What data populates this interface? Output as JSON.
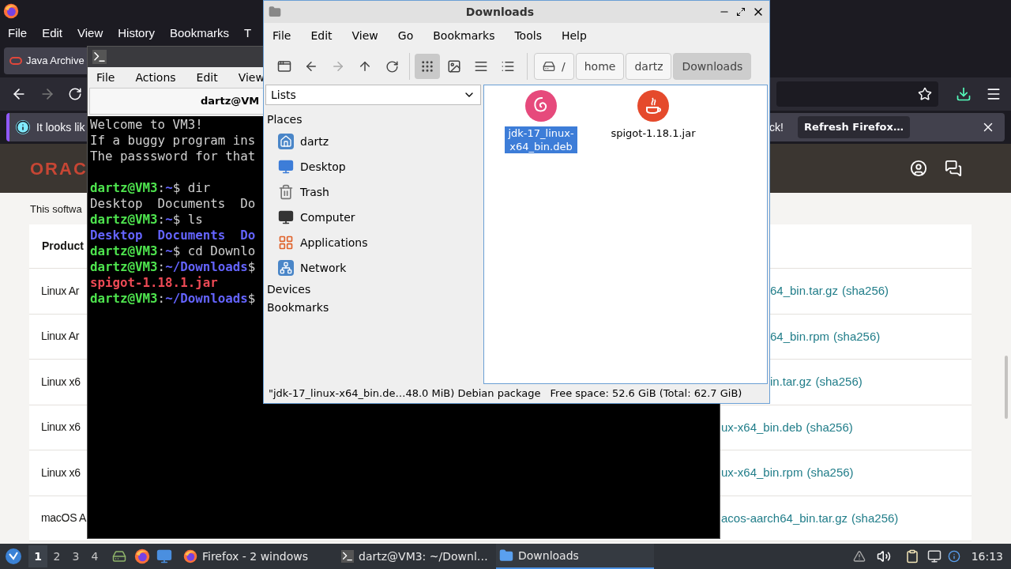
{
  "firefox": {
    "menu": [
      "File",
      "Edit",
      "View",
      "History",
      "Bookmarks",
      "T"
    ],
    "tab": {
      "title": "Java Archive"
    },
    "nav": {
      "back_disabled": false,
      "forward_disabled": true
    },
    "notification": {
      "text": "It looks lik",
      "text_end": "ck!",
      "button": "Refresh Firefox…"
    },
    "site": {
      "logo": "ORAC",
      "notice": "This softwa",
      "header": "Product",
      "rows": [
        {
          "product": "Linux Ar",
          "file": "64_bin.tar.gz",
          "checksum": "(sha256)"
        },
        {
          "product": "Linux Ar",
          "file": "64_bin.rpm",
          "checksum": "(sha256)"
        },
        {
          "product": "Linux x6",
          "file": "in.tar.gz",
          "checksum": "(sha256)"
        },
        {
          "product": "Linux x6",
          "file": "ux-x64_bin.deb",
          "checksum": "(sha256)"
        },
        {
          "product": "Linux x6",
          "file": "ux-x64_bin.rpm",
          "checksum": "(sha256)"
        },
        {
          "product": "macOS A",
          "file": "acos-aarch64_bin.tar.gz",
          "checksum": "(sha256)"
        }
      ]
    }
  },
  "terminal": {
    "menu": [
      "File",
      "Actions",
      "Edit",
      "View"
    ],
    "title": "dartz@VM",
    "lines": [
      {
        "segments": [
          {
            "text": "Welcome to VM3!",
            "kind": "plain"
          }
        ]
      },
      {
        "segments": [
          {
            "text": "If a buggy program ins",
            "kind": "plain"
          }
        ]
      },
      {
        "segments": [
          {
            "text": "The passsword for that",
            "kind": "plain"
          }
        ]
      },
      {
        "kind": "blank"
      },
      {
        "segments": [
          {
            "text": "dartz@VM3",
            "kind": "user"
          },
          {
            "text": ":",
            "kind": "plain"
          },
          {
            "text": "~",
            "kind": "path"
          },
          {
            "text": "$ dir",
            "kind": "plain"
          }
        ]
      },
      {
        "segments": [
          {
            "text": "Desktop  Documents  Do",
            "kind": "plain"
          }
        ]
      },
      {
        "segments": [
          {
            "text": "dartz@VM3",
            "kind": "user"
          },
          {
            "text": ":",
            "kind": "plain"
          },
          {
            "text": "~",
            "kind": "path"
          },
          {
            "text": "$ ls",
            "kind": "plain"
          }
        ]
      },
      {
        "segments": [
          {
            "text": "Desktop  Documents  Do",
            "kind": "dir"
          }
        ]
      },
      {
        "segments": [
          {
            "text": "dartz@VM3",
            "kind": "user"
          },
          {
            "text": ":",
            "kind": "plain"
          },
          {
            "text": "~",
            "kind": "path"
          },
          {
            "text": "$ cd Downlo",
            "kind": "plain"
          }
        ]
      },
      {
        "segments": [
          {
            "text": "dartz@VM3",
            "kind": "user"
          },
          {
            "text": ":",
            "kind": "plain"
          },
          {
            "text": "~/Downloads",
            "kind": "path"
          },
          {
            "text": "$",
            "kind": "plain"
          }
        ]
      },
      {
        "segments": [
          {
            "text": "spigot-1.18.1.jar",
            "kind": "file"
          }
        ]
      },
      {
        "segments": [
          {
            "text": "dartz@VM3",
            "kind": "user"
          },
          {
            "text": ":",
            "kind": "plain"
          },
          {
            "text": "~/Downloads",
            "kind": "path"
          },
          {
            "text": "$",
            "kind": "plain"
          }
        ]
      }
    ]
  },
  "file_manager": {
    "title": "Downloads",
    "menu": [
      "File",
      "Edit",
      "View",
      "Go",
      "Bookmarks",
      "Tools",
      "Help"
    ],
    "views": [
      {
        "kind": "icon",
        "selected": true
      },
      {
        "kind": "thumbnail",
        "selected": false
      },
      {
        "kind": "compact",
        "selected": false
      },
      {
        "kind": "detailed",
        "selected": false
      }
    ],
    "path": [
      {
        "label": "/",
        "kind": "root",
        "selected": false
      },
      {
        "label": "home",
        "kind": "dir",
        "selected": false
      },
      {
        "label": "dartz",
        "kind": "dir",
        "selected": false
      },
      {
        "label": "Downloads",
        "kind": "dir",
        "selected": true
      }
    ],
    "side_mode": "Lists",
    "places_header": "Places",
    "places": [
      {
        "label": "dartz",
        "kind": "home"
      },
      {
        "label": "Desktop",
        "kind": "desktop"
      },
      {
        "label": "Trash",
        "kind": "trash"
      },
      {
        "label": "Computer",
        "kind": "computer"
      },
      {
        "label": "Applications",
        "kind": "apps"
      },
      {
        "label": "Network",
        "kind": "network"
      }
    ],
    "sections": [
      "Devices",
      "Bookmarks"
    ],
    "files": [
      {
        "name": "jdk-17_linux-x64_bin.deb",
        "kind": "debian",
        "selected": true
      },
      {
        "name": "spigot-1.18.1.jar",
        "kind": "java",
        "selected": false
      }
    ],
    "status": [
      "\"jdk-17_linux-x64_bin.de…48.0 MiB) Debian package",
      "Free space: 52.6 GiB (Total: 62.7 GiB)"
    ]
  },
  "taskbar": {
    "workspaces": [
      {
        "label": "1",
        "selected": true
      },
      {
        "label": "2",
        "selected": false
      },
      {
        "label": "3",
        "selected": false
      },
      {
        "label": "4",
        "selected": false
      }
    ],
    "tasks": [
      {
        "label": "Firefox - 2 windows",
        "kind": "firefox",
        "selected": false
      },
      {
        "label": "dartz@VM3: ~/Downl…",
        "kind": "terminal",
        "selected": false
      },
      {
        "label": "Downloads",
        "kind": "folder",
        "selected": true
      }
    ],
    "clock": "16:13"
  }
}
